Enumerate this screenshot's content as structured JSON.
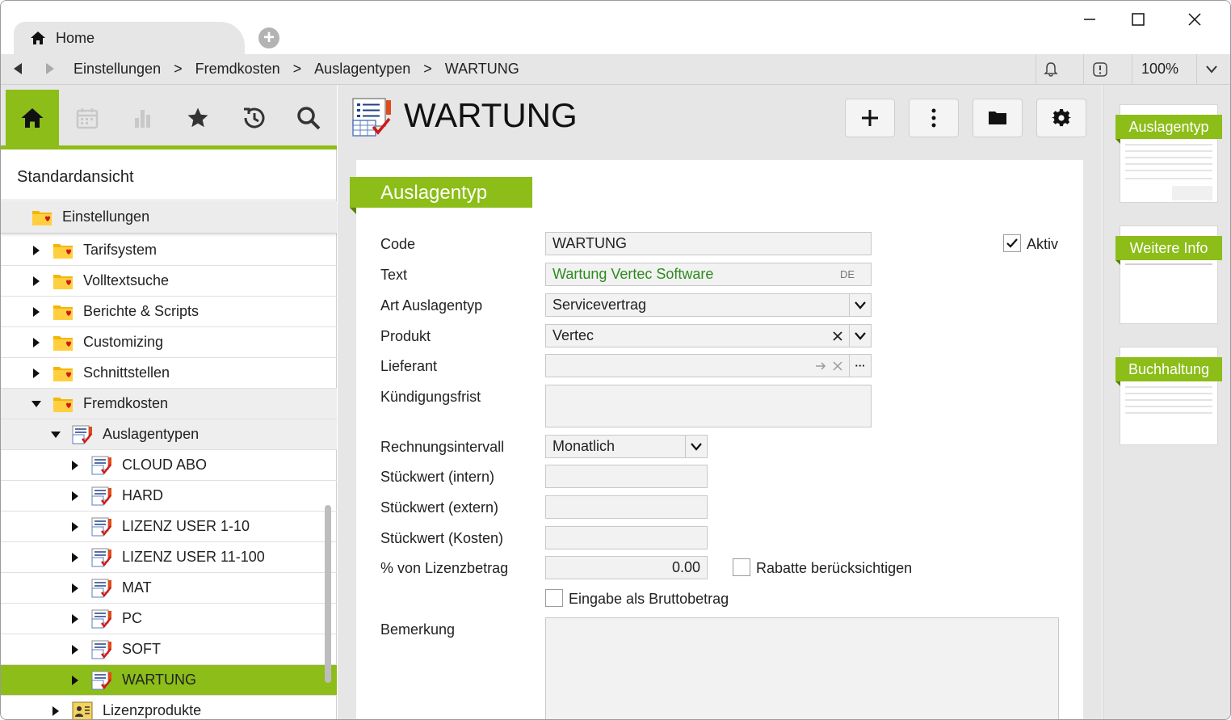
{
  "tab": {
    "label": "Home"
  },
  "breadcrumb": [
    "Einstellungen",
    "Fremdkosten",
    "Auslagentypen",
    "WARTUNG"
  ],
  "breadcrumb_sep": ">",
  "zoom": "100%",
  "sidebar": {
    "view_name": "Standardansicht",
    "root": "Einstellungen",
    "items": [
      {
        "label": "Tarifsystem",
        "level": 1,
        "state": "collapsed",
        "icon": "folder-heart-icon"
      },
      {
        "label": "Volltextsuche",
        "level": 1,
        "state": "collapsed",
        "icon": "folder-heart-icon"
      },
      {
        "label": "Berichte & Scripts",
        "level": 1,
        "state": "collapsed",
        "icon": "folder-heart-icon"
      },
      {
        "label": "Customizing",
        "level": 1,
        "state": "collapsed",
        "icon": "folder-heart-icon"
      },
      {
        "label": "Schnittstellen",
        "level": 1,
        "state": "collapsed",
        "icon": "folder-heart-icon"
      },
      {
        "label": "Fremdkosten",
        "level": 1,
        "state": "expanded",
        "icon": "folder-heart-icon"
      },
      {
        "label": "Auslagentypen",
        "level": 2,
        "state": "expanded",
        "icon": "expense-type-icon"
      },
      {
        "label": "CLOUD ABO",
        "level": 3,
        "state": "collapsed",
        "icon": "expense-type-icon"
      },
      {
        "label": "HARD",
        "level": 3,
        "state": "collapsed",
        "icon": "expense-type-icon"
      },
      {
        "label": "LIZENZ USER 1-10",
        "level": 3,
        "state": "collapsed",
        "icon": "expense-type-icon"
      },
      {
        "label": "LIZENZ USER 11-100",
        "level": 3,
        "state": "collapsed",
        "icon": "expense-type-icon"
      },
      {
        "label": "MAT",
        "level": 3,
        "state": "collapsed",
        "icon": "expense-type-icon"
      },
      {
        "label": "PC",
        "level": 3,
        "state": "collapsed",
        "icon": "expense-type-icon"
      },
      {
        "label": "SOFT",
        "level": 3,
        "state": "collapsed",
        "icon": "expense-type-icon"
      },
      {
        "label": "WARTUNG",
        "level": 3,
        "state": "selected",
        "icon": "expense-type-icon"
      },
      {
        "label": "Lizenzprodukte",
        "level": 2,
        "state": "collapsed",
        "icon": "product-card-icon"
      }
    ]
  },
  "main": {
    "title": "WARTUNG",
    "section": "Auslagentyp",
    "labels": {
      "code": "Code",
      "text": "Text",
      "art": "Art Auslagentyp",
      "produkt": "Produkt",
      "lieferant": "Lieferant",
      "kuendigung": "Kündigungsfrist",
      "rechnungsintervall": "Rechnungsintervall",
      "stueck_intern": "Stückwert (intern)",
      "stueck_extern": "Stückwert (extern)",
      "stueck_kosten": "Stückwert (Kosten)",
      "lizenzbetrag": "% von Lizenzbetrag",
      "bemerkung": "Bemerkung"
    },
    "values": {
      "code": "WARTUNG",
      "text": "Wartung Vertec Software",
      "text_lang": "DE",
      "art": "Servicevertrag",
      "produkt": "Vertec",
      "lieferant": "",
      "kuendigung": "",
      "rechnungsintervall": "Monatlich",
      "stueck_intern": "",
      "stueck_extern": "",
      "stueck_kosten": "",
      "lizenzbetrag": "0.00",
      "bemerkung": ""
    },
    "checkboxes": {
      "aktiv": {
        "label": "Aktiv",
        "checked": true
      },
      "rabatte": {
        "label": "Rabatte berücksichtigen",
        "checked": false
      },
      "brutto": {
        "label": "Eingabe als Bruttobetrag",
        "checked": false
      }
    },
    "ellipsis": "···"
  },
  "right_panel": {
    "pages": [
      "Auslagentyp",
      "Weitere Info",
      "Buchhaltung"
    ]
  },
  "colors": {
    "accent": "#8cbd18",
    "text_link": "#2e8b1f",
    "pane_bg": "#e6e6e6"
  }
}
